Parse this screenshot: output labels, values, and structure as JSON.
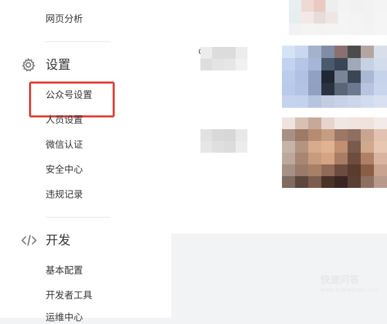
{
  "sidebar": {
    "items": {
      "web_analytics": "网页分析",
      "public_account_settings": "公众号设置",
      "member_settings": "人员设置",
      "wechat_verification": "微信认证",
      "security_center": "安全中心",
      "violation_records": "违规记录",
      "basic_config": "基本配置",
      "developer_tools": "开发者工具",
      "ops_center": "运维中心"
    },
    "sections": {
      "settings": "设置",
      "development": "开发"
    }
  },
  "main": {
    "row1_label_initial": "C"
  },
  "watermark": {
    "text": "快速问答",
    "url": "www.kuaiwenda.com"
  },
  "colors": {
    "highlight_border": "#e0403a",
    "sidebar_bg": "#ffffff",
    "page_bg": "#f2f3f5"
  },
  "icons": {
    "settings": "gear-icon",
    "development": "code-icon"
  }
}
